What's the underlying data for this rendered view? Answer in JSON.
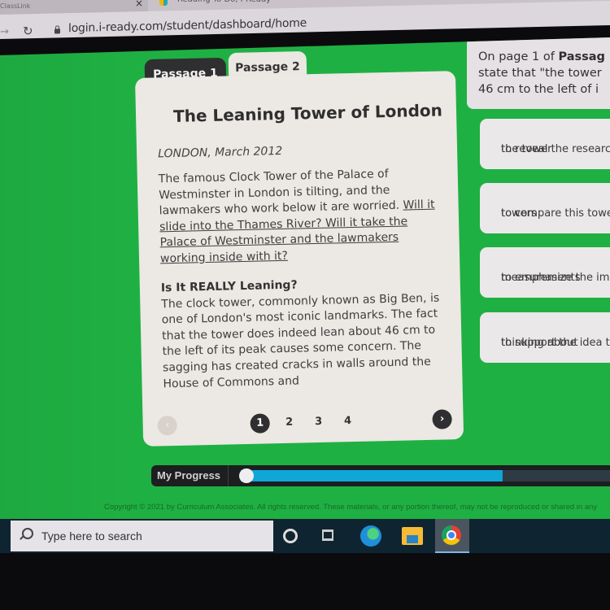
{
  "browser": {
    "tabs": [
      {
        "title": "ClassLink",
        "active": false
      },
      {
        "title": "Reading To Do, i-Ready",
        "active": true
      }
    ],
    "url": "login.i-ready.com/student/dashboard/home"
  },
  "passage_tabs": [
    {
      "label": "Passage 1",
      "selected": true
    },
    {
      "label": "Passage 2",
      "selected": false
    }
  ],
  "passage": {
    "title": "The Leaning Tower of London",
    "dateline": "LONDON, March 2012",
    "paragraph1_plain": "The famous Clock Tower of the Palace of Westminster in London is tilting, and the lawmakers who work below it are worried. ",
    "paragraph1_underlined": "Will it slide into the Thames River? Will it take the Palace of Westminster and the lawmakers working inside with it?",
    "section_heading": "Is It REALLY Leaning?",
    "section_text": "The clock tower, commonly known as Big Ben, is one of London's most iconic landmarks. The fact that the tower does indeed lean about 46 cm to the left of its peak causes some concern. The sagging has created cracks in walls around the House of Commons and"
  },
  "pager": {
    "prev_icon": "chevron-left-icon",
    "next_icon": "chevron-right-icon",
    "prev_glyph": "‹",
    "next_glyph": "›",
    "pages": [
      "1",
      "2",
      "3",
      "4"
    ],
    "current_page": 1
  },
  "question": {
    "prefix": "On page 1 of ",
    "bold": "Passag",
    "line2": "state that \"the tower",
    "line3": "46 cm to the left of i"
  },
  "answers": [
    {
      "line1": "to reveal the researc",
      "line2": "the tower"
    },
    {
      "line1": "to compare this towe",
      "line2": "towers"
    },
    {
      "line1": "to emphasize the im",
      "line2": "measurements"
    },
    {
      "line1": "to support the idea t",
      "line2": "thinking about"
    }
  ],
  "progress": {
    "label": "My Progress",
    "percent": 70
  },
  "footer": {
    "copyright": "Copyright © 2021 by Curriculum Associates. All rights reserved. These materials, or any portion thereof, may not be reproduced or shared in any"
  },
  "taskbar": {
    "search_placeholder": "Type here to search",
    "icons": [
      "cortana-icon",
      "task-view-icon",
      "edge-icon",
      "file-explorer-icon",
      "chrome-icon"
    ]
  },
  "colors": {
    "app_green": "#1fb043",
    "progress_fill": "#10a6d8",
    "dark_tab": "#2f2f31",
    "card_bg": "#ece8e3"
  }
}
